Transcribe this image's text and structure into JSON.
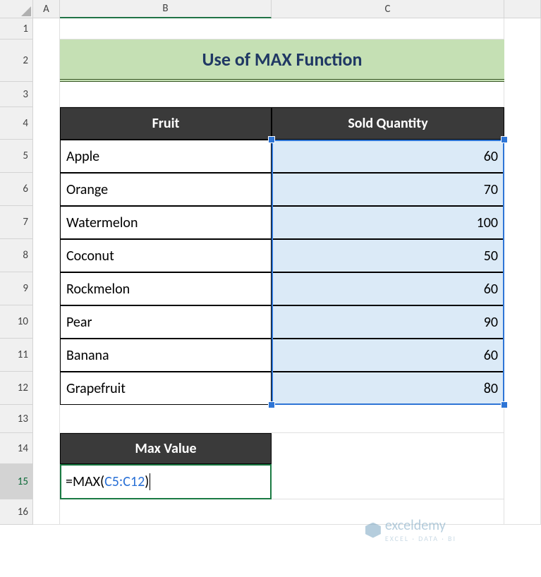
{
  "columns": {
    "A": "A",
    "B": "B",
    "C": "C",
    "D": ""
  },
  "rows": [
    "1",
    "2",
    "3",
    "4",
    "5",
    "6",
    "7",
    "8",
    "9",
    "10",
    "11",
    "12",
    "13",
    "14",
    "15",
    "16"
  ],
  "title": "Use of MAX Function",
  "table": {
    "headers": {
      "fruit": "Fruit",
      "qty": "Sold Quantity"
    },
    "data": [
      {
        "fruit": "Apple",
        "qty": "60"
      },
      {
        "fruit": "Orange",
        "qty": "70"
      },
      {
        "fruit": "Watermelon",
        "qty": "100"
      },
      {
        "fruit": "Coconut",
        "qty": "50"
      },
      {
        "fruit": "Rockmelon",
        "qty": "60"
      },
      {
        "fruit": "Pear",
        "qty": "90"
      },
      {
        "fruit": "Banana",
        "qty": "60"
      },
      {
        "fruit": "Grapefruit",
        "qty": "80"
      }
    ]
  },
  "max": {
    "label": "Max Value",
    "formula_eq": "=",
    "formula_fn": "MAX",
    "formula_open": "(",
    "formula_range": "C5:C12",
    "formula_close": ")"
  },
  "watermark": {
    "text": "exceldemy",
    "sub": "EXCEL · DATA · BI"
  },
  "chart_data": {
    "type": "table",
    "categories": [
      "Apple",
      "Orange",
      "Watermelon",
      "Coconut",
      "Rockmelon",
      "Pear",
      "Banana",
      "Grapefruit"
    ],
    "values": [
      60,
      70,
      100,
      50,
      60,
      90,
      60,
      80
    ],
    "title": "Use of MAX Function",
    "xlabel": "Fruit",
    "ylabel": "Sold Quantity"
  }
}
